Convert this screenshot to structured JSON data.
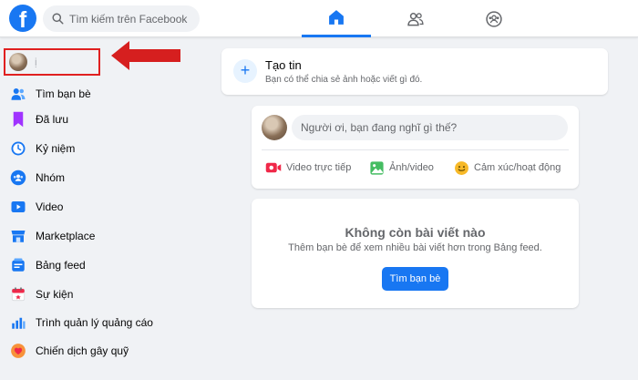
{
  "topbar": {
    "logo_letter": "f",
    "search_placeholder": "Tìm kiếm trên Facebook",
    "tabs": [
      {
        "name": "home",
        "icon": "home-icon",
        "active": true
      },
      {
        "name": "friends",
        "icon": "friends-icon",
        "active": false
      },
      {
        "name": "groups",
        "icon": "groups-icon",
        "active": false
      }
    ]
  },
  "sidebar": {
    "profile_name": "ị",
    "items": [
      {
        "label": "Tìm bạn bè",
        "icon": "friends-icon"
      },
      {
        "label": "Đã lưu",
        "icon": "bookmark-icon"
      },
      {
        "label": "Kỷ niệm",
        "icon": "clock-icon"
      },
      {
        "label": "Nhóm",
        "icon": "groups-icon"
      },
      {
        "label": "Video",
        "icon": "video-icon"
      },
      {
        "label": "Marketplace",
        "icon": "store-icon"
      },
      {
        "label": "Bảng feed",
        "icon": "feed-icon"
      },
      {
        "label": "Sự kiện",
        "icon": "calendar-icon"
      },
      {
        "label": "Trình quản lý quảng cáo",
        "icon": "chart-icon"
      },
      {
        "label": "Chiến dịch gây quỹ",
        "icon": "heart-icon"
      }
    ]
  },
  "story": {
    "title": "Tạo tin",
    "subtitle": "Bạn có thể chia sẻ ảnh hoặc viết gì đó."
  },
  "composer": {
    "placeholder": "Người ơi, bạn đang nghĩ gì thế?",
    "actions": [
      {
        "label": "Video trực tiếp",
        "icon": "live-video-icon",
        "color": "#f02849"
      },
      {
        "label": "Ảnh/video",
        "icon": "photo-icon",
        "color": "#45bd62"
      },
      {
        "label": "Cảm xúc/hoạt động",
        "icon": "smile-icon",
        "color": "#f7b928"
      }
    ]
  },
  "empty_feed": {
    "title": "Không còn bài viết nào",
    "subtitle": "Thêm bạn bè để xem nhiều bài viết hơn trong Bảng feed.",
    "button": "Tìm bạn bè"
  },
  "colors": {
    "brand": "#1877f2",
    "highlight": "#e02020",
    "background": "#f0f2f5"
  }
}
